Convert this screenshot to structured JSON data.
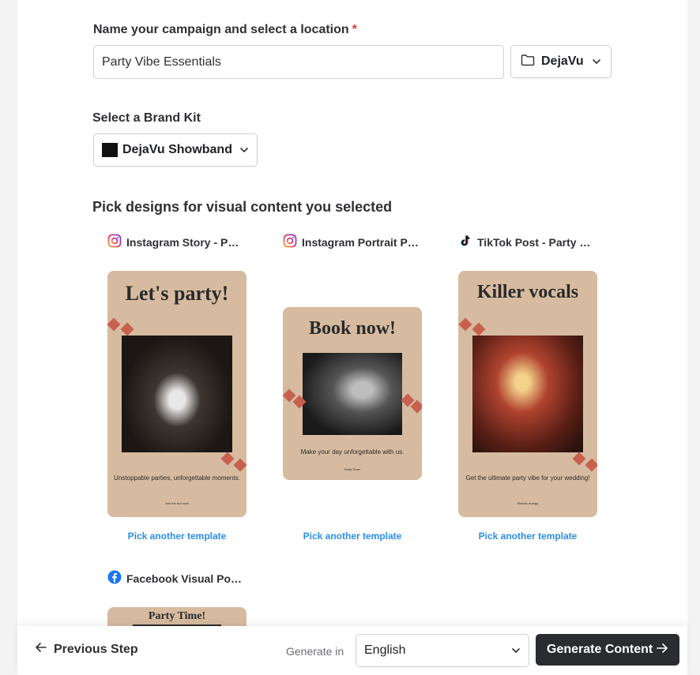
{
  "campaign": {
    "label": "Name your campaign and select a location",
    "required_mark": "*",
    "name_value": "Party Vibe Essentials",
    "location": "DejaVu"
  },
  "brand_kit": {
    "label": "Select a Brand Kit",
    "selected": "DejaVu Showband"
  },
  "designs": {
    "title": "Pick designs for visual content you selected",
    "items": [
      {
        "platform": "Instagram Story - Party Vibe Essentials",
        "icon": "instagram-icon",
        "headline": "Let's party!",
        "caption": "Unstoppable parties, unforgettable moments.",
        "small": "Join the fun now!",
        "link": "Pick another template"
      },
      {
        "platform": "Instagram Portrait Post - Party Vibe Essentials",
        "icon": "instagram-icon",
        "headline": "Book now!",
        "caption": "Make your day unforgettable with us.",
        "small": "Party Time!",
        "link": "Pick another template"
      },
      {
        "platform": "TikTok Post - Party Vibe Essentials",
        "icon": "tiktok-icon",
        "headline": "Killer vocals",
        "caption": "Get the ultimate party vibe for your wedding!",
        "small": "Electric energy",
        "link": "Pick another template"
      },
      {
        "platform": "Facebook Visual Post - Party Vibe Essentials",
        "icon": "facebook-icon",
        "headline": "Party Time!"
      }
    ]
  },
  "footer": {
    "previous": "Previous Step",
    "generate_in": "Generate in",
    "language": "English",
    "generate": "Generate Content"
  },
  "colors": {
    "accent_link": "#2b8ee8",
    "template_bg": "#d6bba0",
    "diamond": "#c8604e",
    "primary_button": "#2b2c2f"
  }
}
